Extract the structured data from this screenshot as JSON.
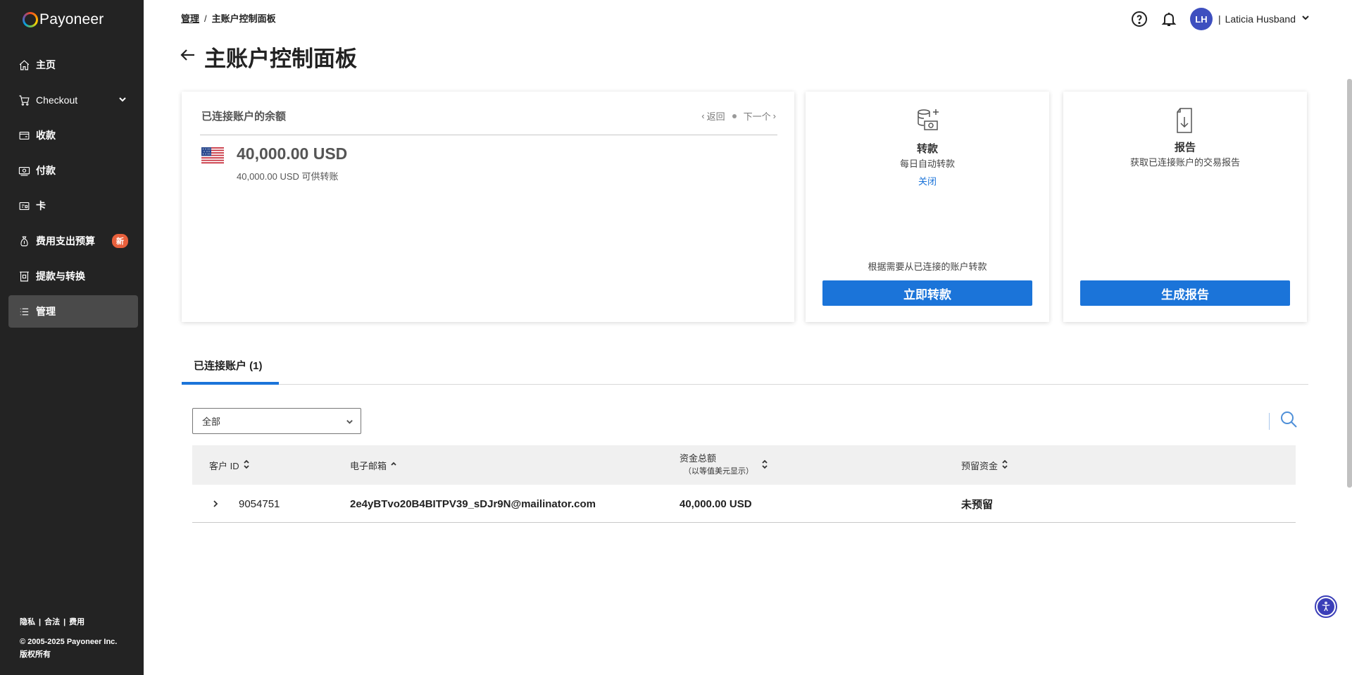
{
  "brand": {
    "name": "Payoneer"
  },
  "sidebar": {
    "items": [
      {
        "label": "主页",
        "icon": "home-icon"
      },
      {
        "label": "Checkout",
        "icon": "cart-icon"
      },
      {
        "label": "收款",
        "icon": "receive-icon"
      },
      {
        "label": "付款",
        "icon": "pay-icon"
      },
      {
        "label": "卡",
        "icon": "card-icon"
      },
      {
        "label": "费用支出预算",
        "icon": "budget-icon",
        "badge": "新"
      },
      {
        "label": "提款与转换",
        "icon": "withdraw-icon"
      },
      {
        "label": "管理",
        "icon": "list-icon",
        "active": true
      }
    ],
    "footer": {
      "privacy": "隐私",
      "legal": "合法",
      "fees": "费用",
      "sep": "|"
    },
    "copyright": "© 2005-2025 Payoneer Inc.",
    "rights": "版权所有"
  },
  "breadcrumb": {
    "parent": "管理",
    "sep": "/",
    "current": "主账户控制面板"
  },
  "header": {
    "title": "主账户控制面板",
    "user_initials": "LH",
    "user_sep": "|",
    "user_name": "Laticia Husband"
  },
  "balance": {
    "heading": "已连接账户的余额",
    "prev": "返回",
    "next": "下一个",
    "amount": "40,000.00 USD",
    "available": "40,000.00 USD 可供转账"
  },
  "transfer": {
    "title": "转款",
    "subtitle": "每日自动转款",
    "toggle_link": "关闭",
    "note": "根据需要从已连接的账户转款",
    "button": "立即转款"
  },
  "report": {
    "title": "报告",
    "subtitle": "获取已连接账户的交易报告",
    "button": "生成报告"
  },
  "tabs": {
    "connected": "已连接账户 (1)"
  },
  "filter": {
    "selected": "全部"
  },
  "table": {
    "headers": {
      "customer_id": "客户 ID",
      "email": "电子邮箱",
      "total_funds": "资金总额",
      "total_funds_sub": "（以等值美元显示）",
      "reserved": "预留资金"
    },
    "rows": [
      {
        "customer_id": "9054751",
        "email": "2e4yBTvo20B4BITPV39_sDJr9N@mailinator.com",
        "total_funds": "40,000.00 USD",
        "reserved": "未预留"
      }
    ]
  },
  "colors": {
    "sidebar_bg": "#232323",
    "primary": "#1b74d9",
    "badge": "#e8603c",
    "avatar": "#3e4fbf"
  }
}
